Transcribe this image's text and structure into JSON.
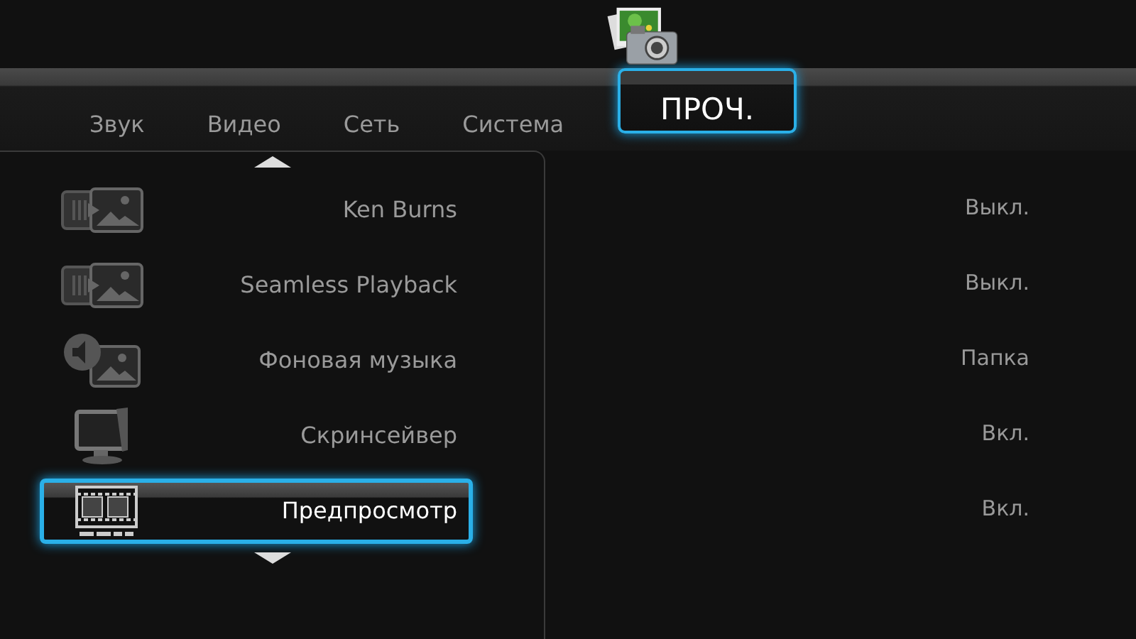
{
  "tabs": [
    {
      "label": "Звук",
      "selected": false
    },
    {
      "label": "Видео",
      "selected": false
    },
    {
      "label": "Сеть",
      "selected": false
    },
    {
      "label": "Система",
      "selected": false
    },
    {
      "label": "ПРОЧ.",
      "selected": true
    }
  ],
  "settings": [
    {
      "kind": "slideshow",
      "label": "Ken Burns",
      "value": "Выкл.",
      "selected": false
    },
    {
      "kind": "slideshow",
      "label": "Seamless Playback",
      "value": "Выкл.",
      "selected": false
    },
    {
      "kind": "music",
      "label": "Фоновая музыка",
      "value": "Папка",
      "selected": false
    },
    {
      "kind": "tv",
      "label": "Скринсейвер",
      "value": "Вкл.",
      "selected": false
    },
    {
      "kind": "film",
      "label": "Предпросмотр",
      "value": "Вкл.",
      "selected": true
    }
  ]
}
